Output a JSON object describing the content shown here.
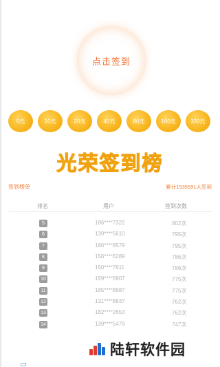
{
  "checkin": {
    "label": "点击签到"
  },
  "rewards": [
    "5元",
    "10元",
    "20元",
    "40元",
    "80元",
    "160元",
    "320元"
  ],
  "honor_title": "光荣签到榜",
  "board": {
    "title": "签到榜单",
    "total": "累计1535591人签到",
    "columns": {
      "rank": "排名",
      "user": "用户",
      "count": "签到次数"
    },
    "rows": [
      {
        "rank": "5",
        "user": "186****7322",
        "count": "802次"
      },
      {
        "rank": "6",
        "user": "139****5610",
        "count": "795次"
      },
      {
        "rank": "7",
        "user": "186****8579",
        "count": "795次"
      },
      {
        "rank": "8",
        "user": "156****6289",
        "count": "786次"
      },
      {
        "rank": "9",
        "user": "150****7611",
        "count": "786次"
      },
      {
        "rank": "10",
        "user": "159****6907",
        "count": "775次"
      },
      {
        "rank": "11",
        "user": "185****8987",
        "count": "775次"
      },
      {
        "rank": "12",
        "user": "131****8837",
        "count": "762次"
      },
      {
        "rank": "13",
        "user": "182****2653",
        "count": "762次"
      },
      {
        "rank": "14",
        "user": "139****5479",
        "count": "747次"
      }
    ]
  },
  "watermark": {
    "text": "陆轩软件园",
    "logo_icon": "bar-logo-icon"
  },
  "colors": {
    "accent": "#f26a2a",
    "coin": "#f8b51d",
    "badge": "#9c9c9c"
  }
}
